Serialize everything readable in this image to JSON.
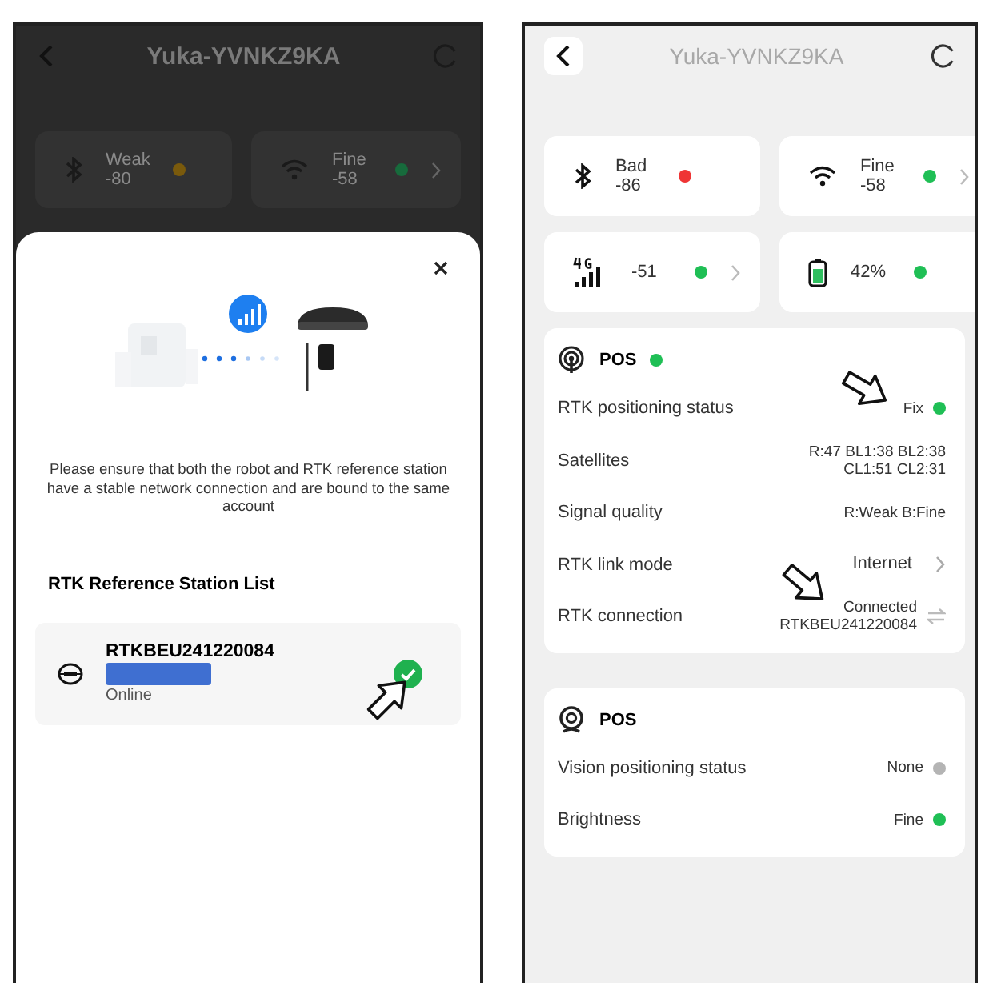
{
  "left_screen": {
    "title": "Yuka-YVNKZ9KA",
    "tiles": [
      {
        "kind": "bluetooth",
        "status": "Weak",
        "reading": "-80",
        "color": "#7a5a0c",
        "chevron": false
      },
      {
        "kind": "wifi",
        "status": "Fine",
        "reading": "-58",
        "color": "#176b3c",
        "chevron": true
      }
    ],
    "sheet": {
      "message": "Please ensure that both the robot and RTK reference station have a stable network connection and are bound to the same account",
      "list_title": "RTK Reference Station List",
      "stations": [
        {
          "name": "RTKBEU241220084",
          "status": "Online",
          "selected": true
        }
      ]
    }
  },
  "right_screen": {
    "title": "Yuka-YVNKZ9KA",
    "tiles": [
      {
        "kind": "bluetooth",
        "status": "Bad",
        "reading": "-86",
        "color": "#ef3535",
        "chevron": false
      },
      {
        "kind": "wifi",
        "status": "Fine",
        "reading": "-58",
        "color": "#1fbf55",
        "chevron": true
      },
      {
        "kind": "cellular",
        "reading": "-51",
        "color": "#1fbf55",
        "chevron": true
      },
      {
        "kind": "battery",
        "reading": "42%",
        "color": "#1fbf55",
        "chevron": false
      }
    ],
    "cards": [
      {
        "kind": "rtk",
        "title": "POS",
        "color": "#1fbf55",
        "rows": [
          {
            "kind": "dot",
            "label": "RTK positioning status",
            "lines": [
              "Fix"
            ],
            "color": "#1fbf55"
          },
          {
            "kind": "plain",
            "label": "Satellites",
            "lines": [
              "R:47  BL1:38 BL2:38",
              "CL1:51 CL2:31"
            ]
          },
          {
            "kind": "plain",
            "label": "Signal quality",
            "lines": [
              "R:Weak B:Fine"
            ]
          },
          {
            "kind": "link",
            "label": "RTK link mode",
            "lines": [
              "Internet"
            ]
          },
          {
            "kind": "swap",
            "label": "RTK connection",
            "lines": [
              "Connected",
              "RTKBEU241220084"
            ]
          }
        ]
      },
      {
        "kind": "vision",
        "title": "POS",
        "rows": [
          {
            "kind": "dot",
            "label": "Vision positioning status",
            "lines": [
              "None"
            ],
            "color": "#b4b4b4"
          },
          {
            "kind": "dot",
            "label": "Brightness",
            "lines": [
              "Fine"
            ],
            "color": "#1fbf55"
          }
        ]
      }
    ]
  }
}
